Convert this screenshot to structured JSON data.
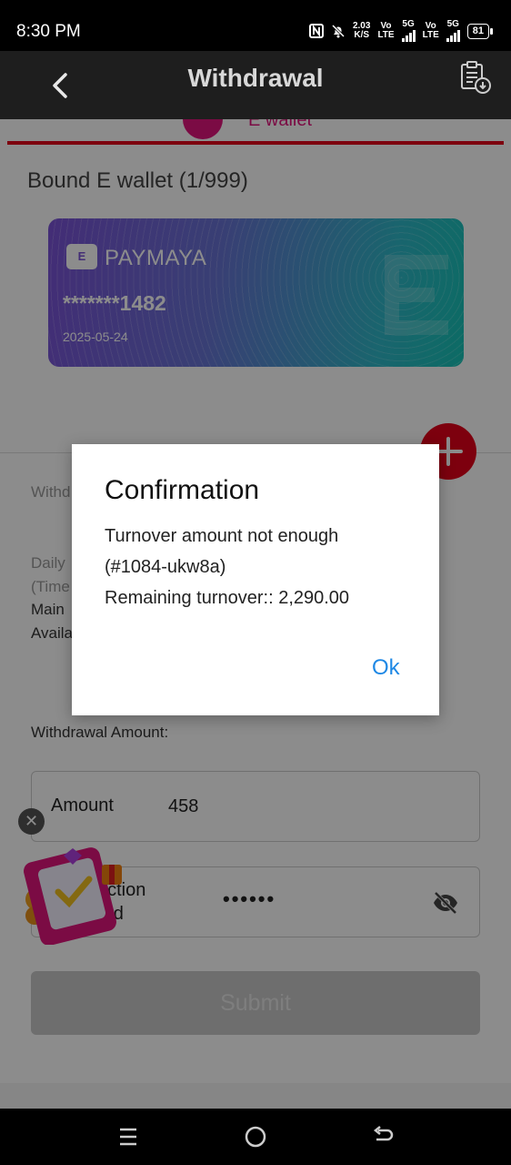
{
  "status_bar": {
    "time": "8:30 PM",
    "net_speed_value": "2.03",
    "net_speed_unit": "K/S",
    "sim1_top": "Vo",
    "sim1_bottom": "LTE",
    "sim1_net": "5G",
    "sim2_top": "Vo",
    "sim2_bottom": "LTE",
    "sim2_net": "5G",
    "battery": "81",
    "icons": [
      "nfc-icon",
      "bell-off-icon",
      "signal-icon",
      "battery-icon"
    ]
  },
  "header": {
    "title": "Withdrawal",
    "icons": [
      "back-arrow-icon",
      "record-clipboard-icon"
    ]
  },
  "tab": {
    "label": "E wallet"
  },
  "bound_wallet": {
    "title": "Bound E wallet (1/999)",
    "card": {
      "logo_text": "E",
      "brand": "PAYMAYA",
      "number": "*******1482",
      "date": "2025-05-24",
      "colors": [
        "#7b52d8",
        "#17c4b8"
      ]
    }
  },
  "background_text": {
    "withdraw_partial": "Withd",
    "daily_partial": "Daily",
    "times_partial": "(Time",
    "main_partial": "Main",
    "avail_partial": "Availa"
  },
  "form": {
    "amount_section_label": "Withdrawal Amount:",
    "amount_label": "Amount",
    "amount_value": "458",
    "tx_label_line1": "action",
    "tx_label_line2": "ord",
    "tx_value": "••••••",
    "submit_label": "Submit"
  },
  "dialog": {
    "title": "Confirmation",
    "line1": "Turnover amount not enough",
    "line2": "(#1084-ukw8a)",
    "line3": "Remaining turnover:: 2,290.00",
    "ok_label": "Ok"
  },
  "nav_bar": {
    "icons": [
      "menu-icon",
      "home-circle-icon",
      "back-icon"
    ]
  },
  "colors": {
    "accent_red": "#e3001b",
    "accent_pink": "#e0147d",
    "link_blue": "#1e88e5"
  }
}
